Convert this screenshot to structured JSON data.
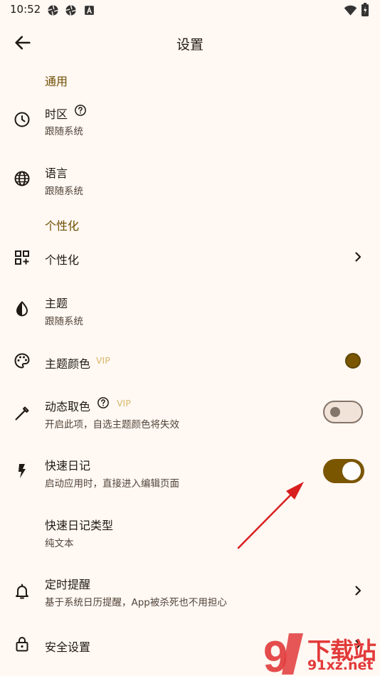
{
  "status": {
    "time": "10:52",
    "icons": [
      "aperture-icon",
      "aperture-icon",
      "font-a-icon",
      "wifi-icon",
      "battery-icon"
    ]
  },
  "appbar": {
    "title": "设置",
    "back_icon": "arrow-back-icon"
  },
  "sections": {
    "general": "通用",
    "personalization": "个性化"
  },
  "rows": {
    "timezone": {
      "label": "时区",
      "sub": "跟随系统",
      "icon": "clock-icon",
      "help_icon": "help-circle-icon"
    },
    "language": {
      "label": "语言",
      "sub": "跟随系统",
      "icon": "globe-icon"
    },
    "personalize": {
      "label": "个性化",
      "icon": "widgets-icon"
    },
    "theme": {
      "label": "主题",
      "sub": "跟随系统",
      "icon": "contrast-icon"
    },
    "theme_color": {
      "label": "主题颜色",
      "vip": "VIP",
      "icon": "palette-icon",
      "color": "#7A5600"
    },
    "dynamic_color": {
      "label": "动态取色",
      "vip": "VIP",
      "sub": "开启此项，自选主题颜色将失效",
      "icon": "eyedropper-icon",
      "enabled": false
    },
    "quick_diary": {
      "label": "快速日记",
      "sub": "启动应用时，直接进入编辑页面",
      "icon": "flash-icon",
      "enabled": true
    },
    "quick_diary_type": {
      "label": "快速日记类型",
      "sub": "纯文本"
    },
    "reminder": {
      "label": "定时提醒",
      "sub": "基于系统日历提醒，App被杀死也不用担心",
      "icon": "bell-icon"
    },
    "security": {
      "label": "安全设置",
      "icon": "lock-icon"
    }
  },
  "colors": {
    "accent": "#7A5600",
    "section": "#6E4E00",
    "background": "#FFF8F3",
    "annotation_arrow": "#D81E1E"
  },
  "watermark": {
    "logo_text": "下载站",
    "domain": "91xz.net",
    "number": "9"
  }
}
